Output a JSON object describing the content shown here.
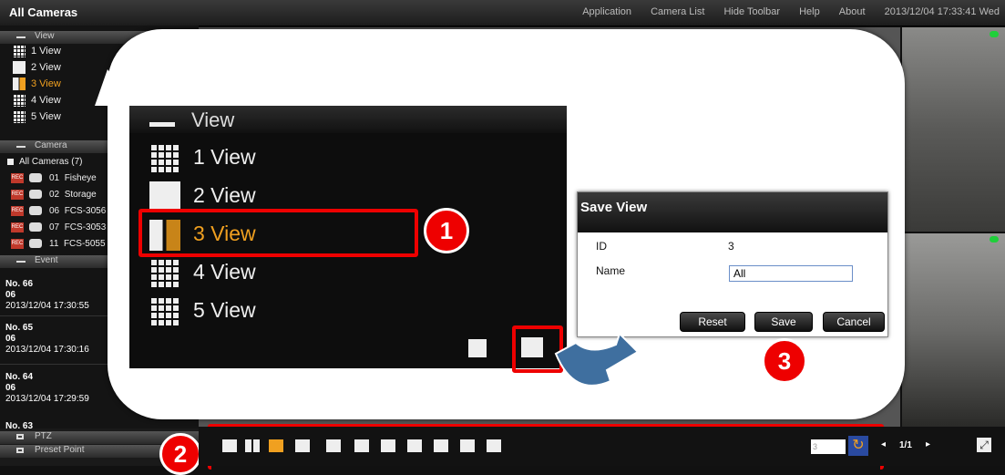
{
  "app": {
    "title": "All Cameras",
    "menu": [
      "Application",
      "Camera List",
      "Hide Toolbar",
      "Help",
      "About"
    ],
    "datetime": "2013/12/04 17:33:41 Wed"
  },
  "sidebar": {
    "view_header": "View",
    "views": [
      "1 View",
      "2 View",
      "3 View",
      "4 View",
      "5 View"
    ],
    "selected_view": "3 View",
    "camera_header": "Camera",
    "camera_group": "All Cameras (7)",
    "cameras": [
      {
        "id": "01",
        "name": "Fisheye"
      },
      {
        "id": "02",
        "name": "Storage"
      },
      {
        "id": "06",
        "name": "FCS-3056"
      },
      {
        "id": "07",
        "name": "FCS-3053"
      },
      {
        "id": "11",
        "name": "FCS-5055"
      }
    ],
    "rec_label": "REC",
    "event_header": "Event",
    "events": [
      {
        "no": "No. 66",
        "cam": "06",
        "time": "2013/12/04 17:30:55"
      },
      {
        "no": "No. 65",
        "cam": "06",
        "time": "2013/12/04 17:30:16"
      },
      {
        "no": "No. 64",
        "cam": "06",
        "time": "2013/12/04 17:29:59"
      },
      {
        "no": "No. 63",
        "cam": "",
        "time": ""
      }
    ],
    "ptz_header": "PTZ",
    "preset_header": "Preset Point"
  },
  "zoom": {
    "header": "View",
    "views": [
      "1 View",
      "2 View",
      "3 View",
      "4 View",
      "5 View"
    ],
    "selected_view": "3 View"
  },
  "dialog": {
    "title": "Save View",
    "id_label": "ID",
    "id_value": "3",
    "name_label": "Name",
    "name_value": "All",
    "reset": "Reset",
    "save": "Save",
    "cancel": "Cancel"
  },
  "steps": [
    "1",
    "2",
    "3"
  ],
  "bottom": {
    "page_input": "3",
    "page": "1/1"
  },
  "colors": {
    "highlight": "#e00000",
    "accent": "#f0a020",
    "status_green": "#1fcf3a"
  }
}
